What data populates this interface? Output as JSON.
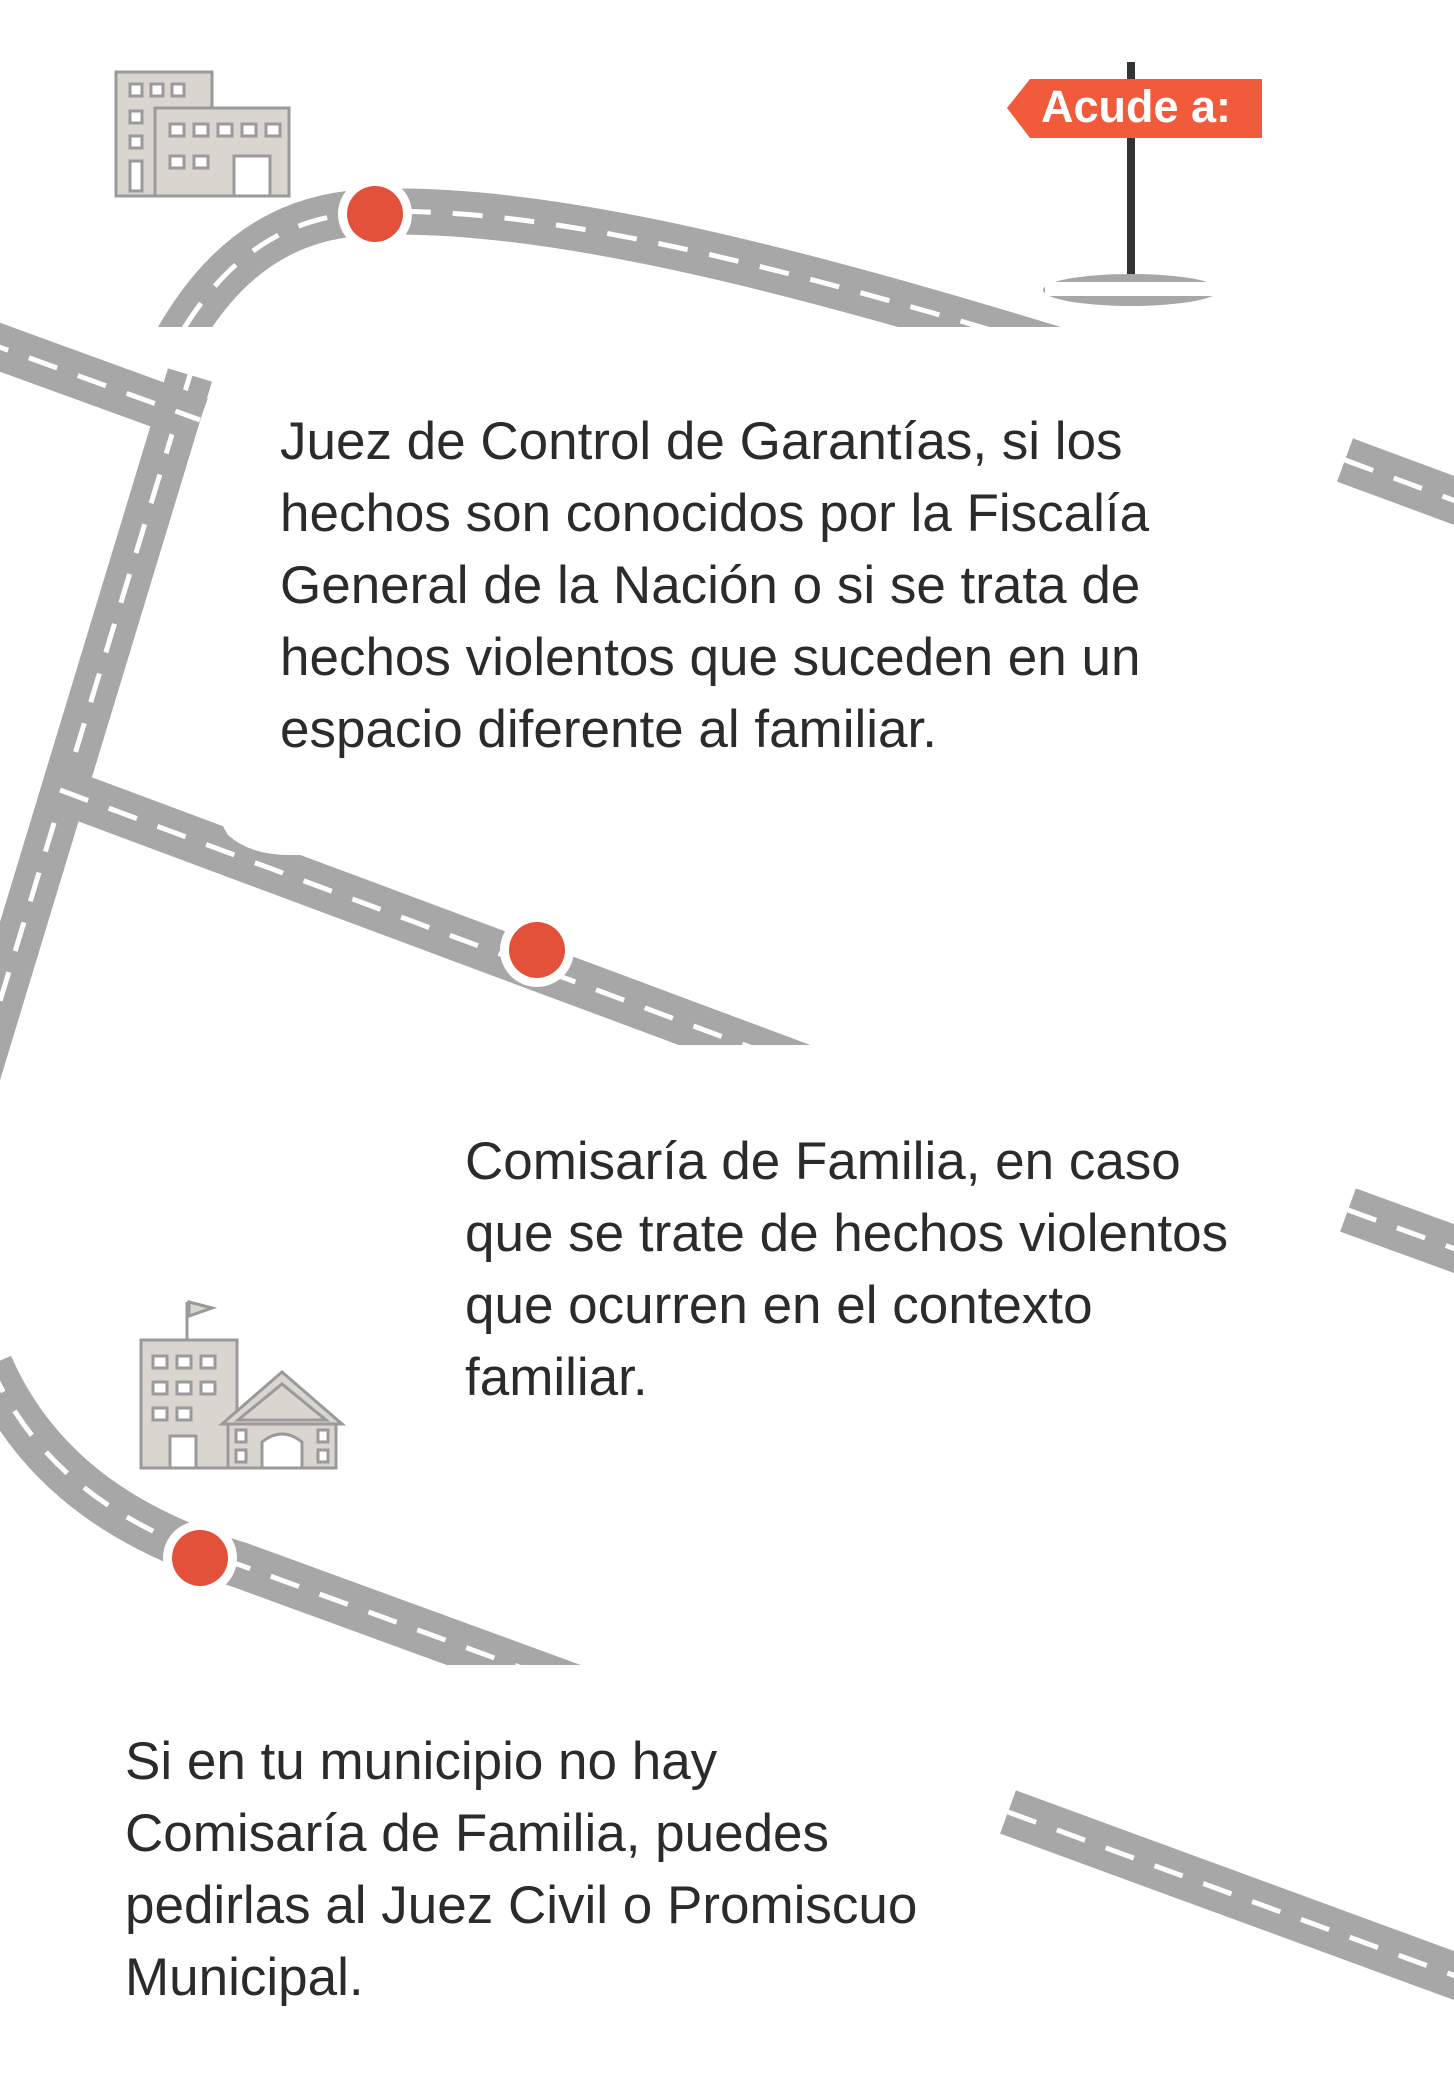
{
  "signpost": {
    "label": "Acude a:"
  },
  "blocks": [
    {
      "text": "Juez de Control de Garantías, si los\nhechos son conocidos por la Fiscalía\nGeneral de la Nación o si se trata de\nhechos violentos que suceden en un\nespacio diferente al familiar."
    },
    {
      "text": "Comisaría de Familia, en caso\nque se trate de hechos violentos\nque ocurren en el contexto\nfamiliar."
    },
    {
      "text": "Si en tu municipio no hay\nComisaría de Familia, puedes\npedirlas al Juez Civil o Promiscuo\nMunicipal."
    }
  ],
  "icons": [
    "office-building-icon",
    "government-building-icon"
  ],
  "colors": {
    "road": "#a7a7a7",
    "marker": "#e4513b",
    "sign": "#f15a3b",
    "building_fill": "#d8d6cf",
    "building_stroke": "#9a9a9a",
    "text": "#2b2b2b"
  }
}
